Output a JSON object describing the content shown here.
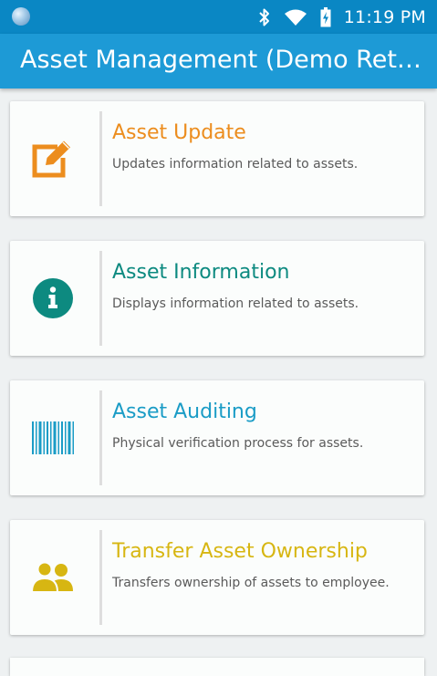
{
  "status_bar": {
    "time": "11:19 PM",
    "icons": [
      "app-icon",
      "bluetooth-icon",
      "wifi-icon",
      "battery-charging-icon"
    ]
  },
  "app_bar": {
    "title": "Asset Management (Demo Ret…"
  },
  "menu": {
    "items": [
      {
        "title": "Asset Update",
        "description": "Updates information related to assets.",
        "icon": "edit-icon",
        "color": "#ec8d1e"
      },
      {
        "title": "Asset Information",
        "description": "Displays information related to assets.",
        "icon": "info-icon",
        "color": "#0d8a80"
      },
      {
        "title": "Asset Auditing",
        "description": "Physical verification process for assets.",
        "icon": "barcode-icon",
        "color": "#1a9cc6"
      },
      {
        "title": "Transfer Asset Ownership",
        "description": "Transfers ownership of assets to employee.",
        "icon": "users-icon",
        "color": "#d7b612"
      }
    ]
  },
  "colors": {
    "status_bar": "#0a87c4",
    "app_bar": "#1d9ad6",
    "background": "#eef1f2",
    "card": "#fbfdfc"
  }
}
